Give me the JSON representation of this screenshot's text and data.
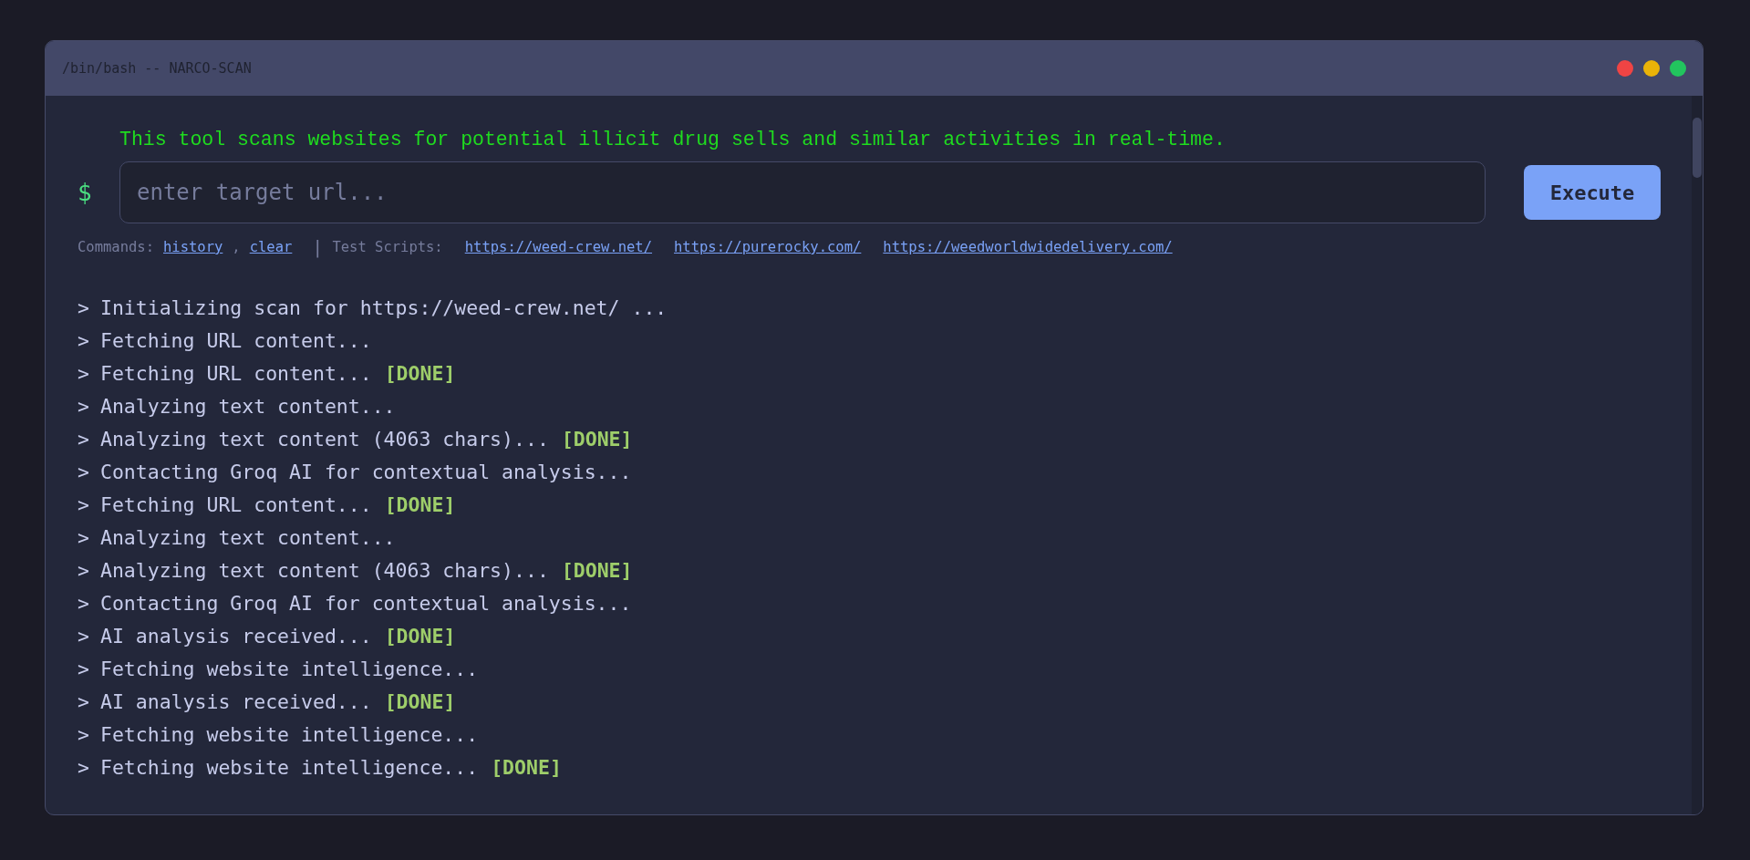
{
  "window": {
    "title": "/bin/bash -- NARCO-SCAN"
  },
  "tagline": "This tool scans websites for potential illicit drug sells and similar activities in real-time.",
  "prompt": "$",
  "url_field": {
    "placeholder": "enter target url..."
  },
  "execute_button": "Execute",
  "commands": {
    "label": "Commands:",
    "links": [
      "history",
      "clear"
    ],
    "separator": ",",
    "divider": "|",
    "scripts_label": "Test Scripts:",
    "scripts": [
      "https://weed-crew.net/",
      "https://purerocky.com/",
      "https://weedworldwidedelivery.com/"
    ]
  },
  "log": [
    {
      "marker": ">",
      "text": "Initializing scan for https://weed-crew.net/ ..."
    },
    {
      "marker": ">",
      "text": "Fetching URL content..."
    },
    {
      "marker": ">",
      "text": "Fetching URL content...",
      "status": "[DONE]"
    },
    {
      "marker": ">",
      "text": "Analyzing text content..."
    },
    {
      "marker": ">",
      "text": "Analyzing text content (4063 chars)...",
      "status": "[DONE]"
    },
    {
      "marker": ">",
      "text": "Contacting Groq AI for contextual analysis..."
    },
    {
      "marker": ">",
      "text": "Fetching URL content...",
      "status": "[DONE]"
    },
    {
      "marker": ">",
      "text": "Analyzing text content..."
    },
    {
      "marker": ">",
      "text": "Analyzing text content (4063 chars)...",
      "status": "[DONE]"
    },
    {
      "marker": ">",
      "text": "Contacting Groq AI for contextual analysis..."
    },
    {
      "marker": ">",
      "text": "AI analysis received...",
      "status": "[DONE]"
    },
    {
      "marker": ">",
      "text": "Fetching website intelligence..."
    },
    {
      "marker": ">",
      "text": "AI analysis received...",
      "status": "[DONE]"
    },
    {
      "marker": ">",
      "text": "Fetching website intelligence..."
    },
    {
      "marker": ">",
      "text": "Fetching website intelligence...",
      "status": "[DONE]"
    }
  ]
}
